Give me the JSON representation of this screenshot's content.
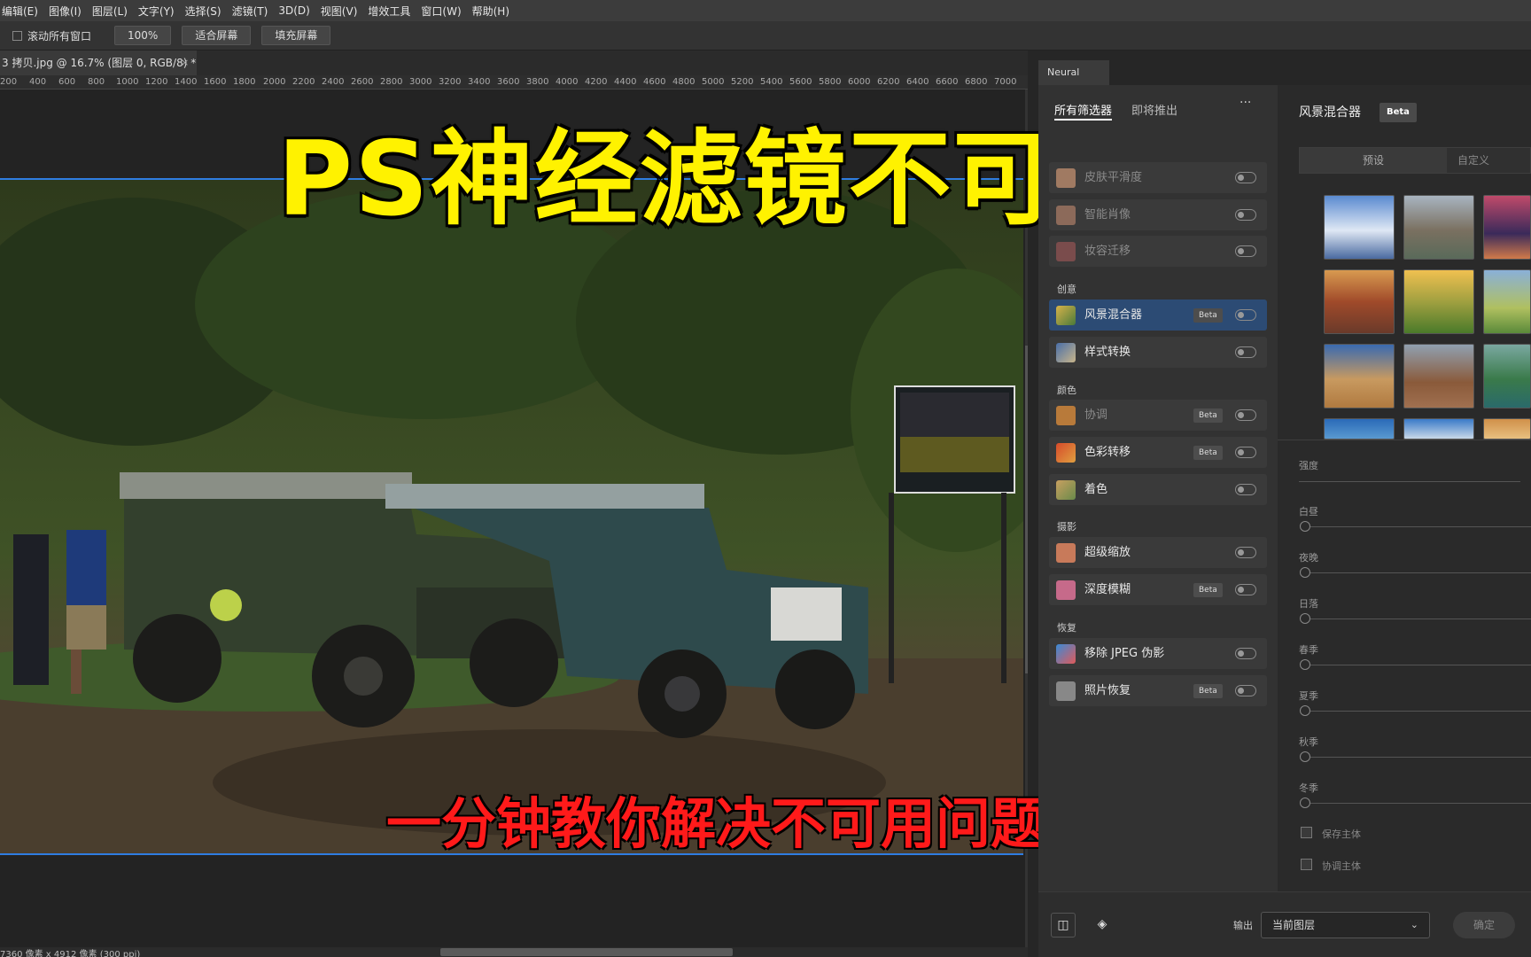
{
  "menu": [
    "编辑(E)",
    "图像(I)",
    "图层(L)",
    "文字(Y)",
    "选择(S)",
    "滤镜(T)",
    "3D(D)",
    "视图(V)",
    "增效工具",
    "窗口(W)",
    "帮助(H)"
  ],
  "options": {
    "scroll_all_label": "滚动所有窗口",
    "zoom_value": "100%",
    "fit_screen": "适合屏幕",
    "fill_screen": "填充屏幕"
  },
  "document": {
    "tab_title": "3 拷贝.jpg @ 16.7% (图层 0, RGB/8) *",
    "close": "×",
    "status": "7360 像素 x 4912 像素 (300 ppi)"
  },
  "ruler_ticks": [
    "200",
    "400",
    "600",
    "800",
    "1000",
    "1200",
    "1400",
    "1600",
    "1800",
    "2000",
    "2200",
    "2400",
    "2600",
    "2800",
    "3000",
    "3200",
    "3400",
    "3600",
    "3800",
    "4000",
    "4200",
    "4400",
    "4600",
    "4800",
    "5000",
    "5200",
    "5400",
    "5600",
    "5800",
    "6000",
    "6200",
    "6400",
    "6600",
    "6800",
    "7000"
  ],
  "overlay": {
    "title": "PS神经滤镜不可用",
    "subtitle": "一分钟教你解决不可用问题"
  },
  "neural_filters": {
    "panel_tab": "Neural Filters",
    "tabs": [
      "所有筛选器",
      "即将推出"
    ],
    "more": "···",
    "sections": {
      "creative": "创意",
      "color": "颜色",
      "photo": "摄影",
      "restore": "恢复"
    },
    "filters_top": [
      "皮肤平滑度",
      "智能肖像",
      "妆容迁移"
    ],
    "filters": {
      "landscape_mixer": {
        "label": "风景混合器",
        "beta": "Beta"
      },
      "style_transfer": {
        "label": "样式转换"
      },
      "harmonize": {
        "label": "协调",
        "beta": "Beta"
      },
      "color_transfer": {
        "label": "色彩转移",
        "beta": "Beta"
      },
      "colorize": {
        "label": "着色"
      },
      "super_zoom": {
        "label": "超级缩放"
      },
      "depth_blur": {
        "label": "深度模糊",
        "beta": "Beta"
      },
      "jpeg_artifacts": {
        "label": "移除 JPEG 伪影"
      },
      "photo_restore": {
        "label": "照片恢复",
        "beta": "Beta"
      }
    },
    "detail": {
      "title": "风景混合器",
      "beta": "Beta",
      "preset_tab": "预设",
      "custom_tab": "自定义",
      "strength": "强度",
      "sliders": [
        "白昼",
        "夜晚",
        "日落",
        "春季",
        "夏季",
        "秋季",
        "冬季"
      ],
      "checkboxes": [
        "保存主体",
        "协调主体"
      ]
    },
    "output_label": "输出",
    "output_value": "当前图层",
    "ok": "确定"
  }
}
